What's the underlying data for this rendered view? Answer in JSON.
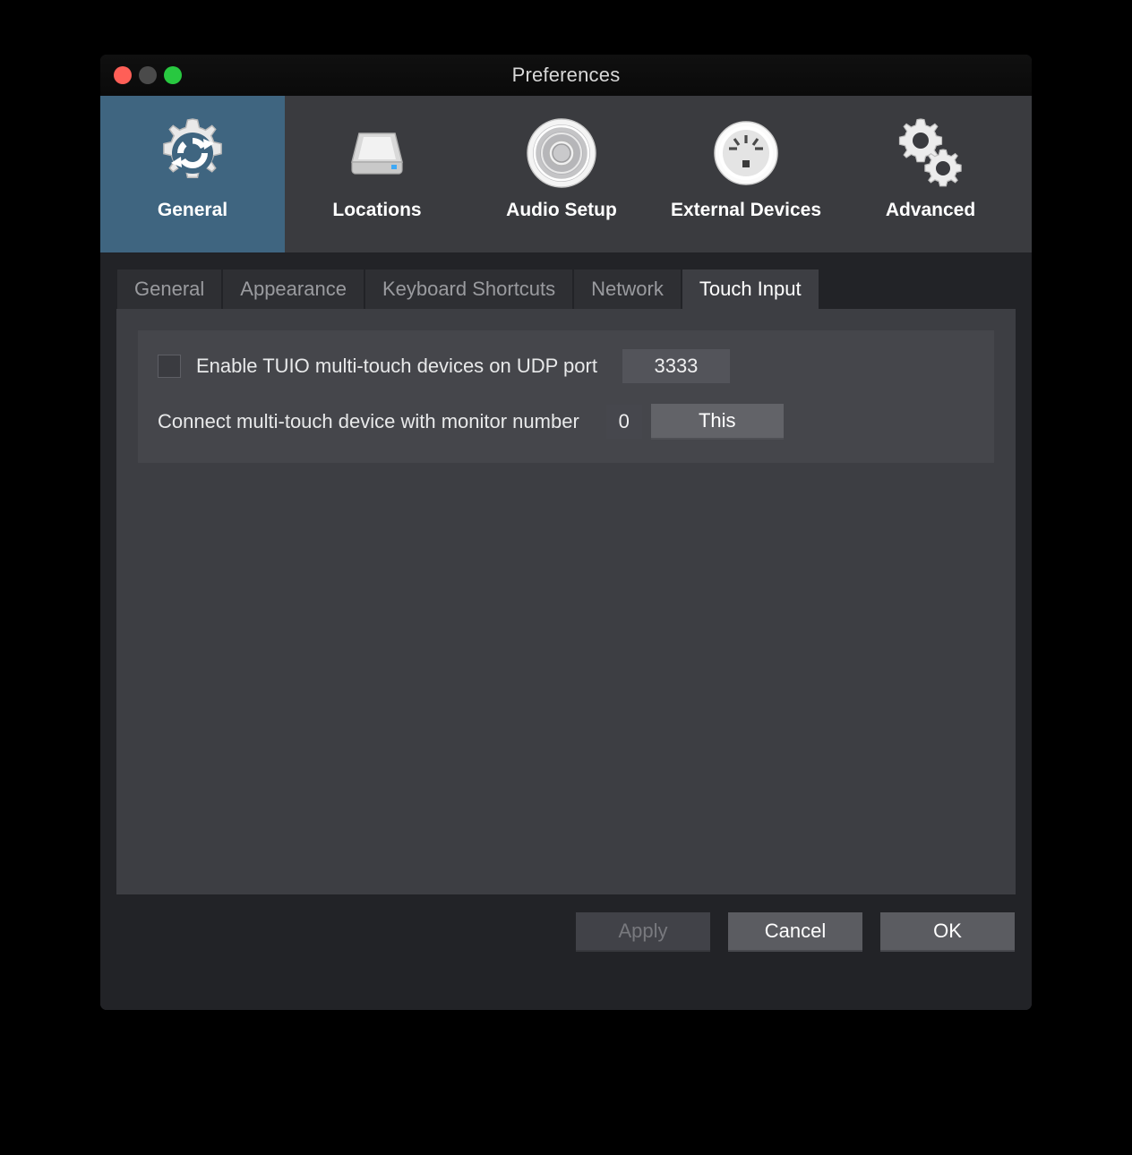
{
  "window": {
    "title": "Preferences",
    "traffic_lights": [
      {
        "name": "close",
        "color": "#ff5f57"
      },
      {
        "name": "minimize",
        "color": "#4a4a4a"
      },
      {
        "name": "zoom",
        "color": "#28c840"
      }
    ]
  },
  "toolbar": {
    "selected": "General",
    "items": [
      {
        "label": "General",
        "icon": "gear-refresh-icon",
        "selected": true
      },
      {
        "label": "Locations",
        "icon": "hard-drive-icon",
        "selected": false
      },
      {
        "label": "Audio Setup",
        "icon": "speaker-icon",
        "selected": false
      },
      {
        "label": "External Devices",
        "icon": "gauge-dial-icon",
        "selected": false
      },
      {
        "label": "Advanced",
        "icon": "double-gear-icon",
        "selected": false
      }
    ]
  },
  "tabs": {
    "selected": "Touch Input",
    "items": [
      {
        "label": "General",
        "active": false
      },
      {
        "label": "Appearance",
        "active": false
      },
      {
        "label": "Keyboard Shortcuts",
        "active": false
      },
      {
        "label": "Network",
        "active": false
      },
      {
        "label": "Touch Input",
        "active": true
      }
    ]
  },
  "touch_input": {
    "tuio": {
      "label": "Enable TUIO multi-touch devices on UDP port",
      "checked": false,
      "port_value": "3333",
      "port_placeholder": "3333"
    },
    "monitor": {
      "label": "Connect multi-touch device with monitor number",
      "value": "0",
      "placeholder": "0",
      "button_label": "This"
    }
  },
  "footer": {
    "apply": {
      "label": "Apply",
      "enabled": false
    },
    "cancel": {
      "label": "Cancel",
      "enabled": true
    },
    "ok": {
      "label": "OK",
      "enabled": true
    }
  },
  "colors": {
    "accent_selected": "#3f6580",
    "window_bg": "#222327",
    "toolbar_bg": "#3a3b3f",
    "panel_bg": "#3d3e43",
    "groupbox_bg": "#45464b",
    "titlebar_bg": "#0d0d0d"
  }
}
